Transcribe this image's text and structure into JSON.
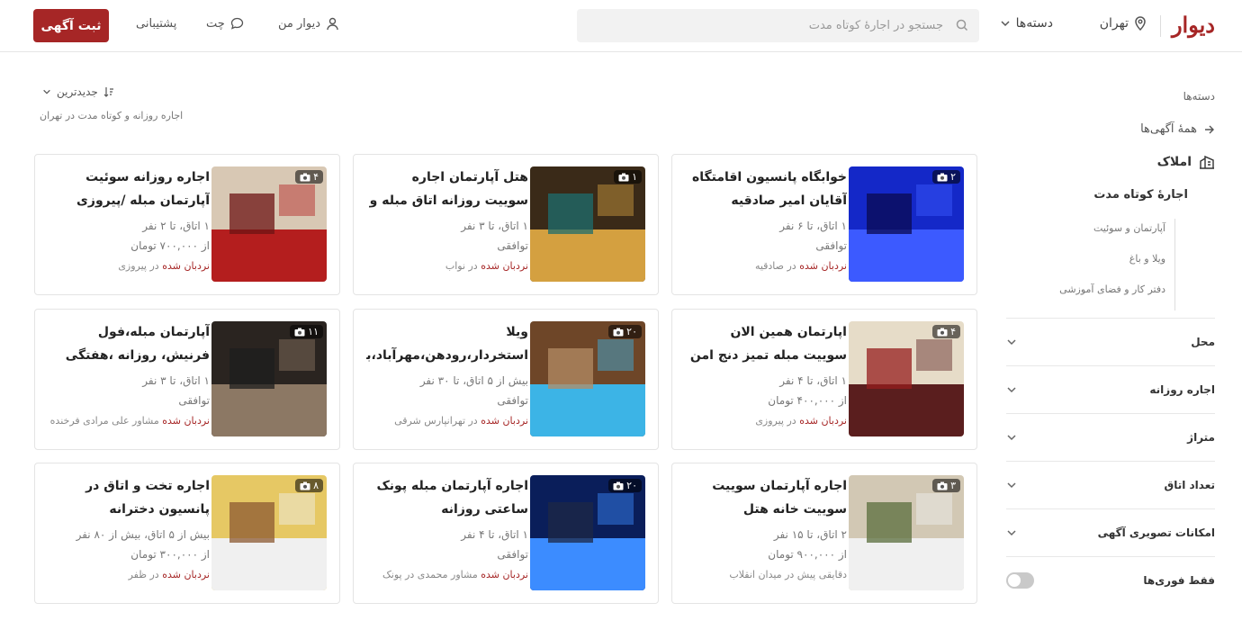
{
  "header": {
    "logo": "دیوار",
    "city": "تهران",
    "categories_label": "دسته‌ها",
    "search_placeholder": "جستجو در اجارهٔ کوتاه مدت",
    "nav_my_divar": "دیوار من",
    "nav_chat": "چت",
    "nav_support": "پشتیبانی",
    "post_button": "ثبت آگهی"
  },
  "sidebar": {
    "title": "دسته‌ها",
    "all_ads": "همهٔ آگهی‌ها",
    "category": "املاک",
    "subcategory": "اجارهٔ کوتاه مدت",
    "subitems": [
      "آپارتمان و سوئیت",
      "ویلا و باغ",
      "دفتر کار و فضای آموزشی"
    ],
    "filters": [
      "محل",
      "اجاره روزانه",
      "متراژ",
      "تعداد اتاق",
      "امکانات تصویری آگهی"
    ],
    "instant_only": "فقط فوری‌ها"
  },
  "main": {
    "sort_label": "جدیدترین",
    "breadcrumb": "اجاره روزانه و کوتاه مدت در تهران"
  },
  "listings": [
    {
      "title": "خوابگاه پانسیون اقامتگاه آقایان امیر صادقیه",
      "line1": "۱ اتاق، تا ۶ نفر",
      "line2": "توافقی",
      "tag": "نردبان شده",
      "location": "در صادقیه",
      "photos": "۲",
      "colors": [
        "#1428c8",
        "#3c5aff",
        "#0a0a50"
      ]
    },
    {
      "title": "هتل آپارتمان اجاره سوییت روزانه اتاق مبله و واحد",
      "line1": "۱ اتاق، تا ۳ نفر",
      "line2": "توافقی",
      "tag": "نردبان شده",
      "location": "در نواب",
      "photos": "۱",
      "colors": [
        "#3a2a18",
        "#d4a040",
        "#1e6e6e"
      ]
    },
    {
      "title": "اجاره روزانه سوئیت آپارتمان مبله /پیروزی",
      "line1": "۱ اتاق، تا ۲ نفر",
      "line2": "از ۷۰۰,۰۰۰ تومان",
      "tag": "نردبان شده",
      "location": "در پیروزی",
      "photos": "۴",
      "colors": [
        "#d8c8b4",
        "#b41e1e",
        "#6e1414"
      ]
    },
    {
      "title": "اپارتمان همین الان سوییت مبله تمیز دنج امن اجاره",
      "line1": "۱ اتاق، تا ۴ نفر",
      "line2": "از ۴۰۰,۰۰۰ تومان",
      "tag": "نردبان شده",
      "location": "در پیروزی",
      "photos": "۴",
      "colors": [
        "#e6dcc8",
        "#5a1e1e",
        "#961e1e"
      ]
    },
    {
      "title": "ویلا استخردار،رودهن،مهرآباد،بومهن",
      "line1": "بیش از ۵ اتاق، تا ۳۰ نفر",
      "line2": "توافقی",
      "tag": "نردبان شده",
      "location": "در تهرانپارس شرقی",
      "photos": "۲۰",
      "colors": [
        "#6e4628",
        "#3cb4e6",
        "#b48c64"
      ]
    },
    {
      "title": "آپارتمان مبله،فول فرنیش، روزانه ،هفتگی ،ماهنه",
      "line1": "۱ اتاق، تا ۳ نفر",
      "line2": "توافقی",
      "tag": "نردبان شده",
      "location": "مشاور علی مرادی فرخنده ...",
      "photos": "۱۱",
      "colors": [
        "#2a2420",
        "#8c7864",
        "#1e1e1e"
      ]
    },
    {
      "title": "اجاره آپارتمان سوییت سوییت خانه هتل",
      "line1": "۲ اتاق، تا ۱۵ نفر",
      "line2": "از ۹۰۰,۰۰۰ تومان",
      "tag": "",
      "location": "دقایقی پیش در میدان انقلاب",
      "photos": "۳",
      "colors": [
        "#d2c8b4",
        "#f0f0f0",
        "#5a6e3c"
      ]
    },
    {
      "title": "اجاره آپارتمان مبله پونک ساعتی روزانه",
      "line1": "۱ اتاق، تا ۴ نفر",
      "line2": "توافقی",
      "tag": "نردبان شده",
      "location": "مشاور محمدی در پونک",
      "photos": "۲۰",
      "colors": [
        "#0a1e5a",
        "#3c8cff",
        "#1e2846"
      ]
    },
    {
      "title": "اجاره تخت و اتاق در پانسیون دخترانه",
      "line1": "بیش از ۵ اتاق، بیش از ۸۰ نفر",
      "line2": "از ۳۰۰,۰۰۰ تومان",
      "tag": "نردبان شده",
      "location": "در ظفر",
      "photos": "۸",
      "colors": [
        "#e6c864",
        "#f0f0f0",
        "#8c5a32"
      ]
    }
  ]
}
